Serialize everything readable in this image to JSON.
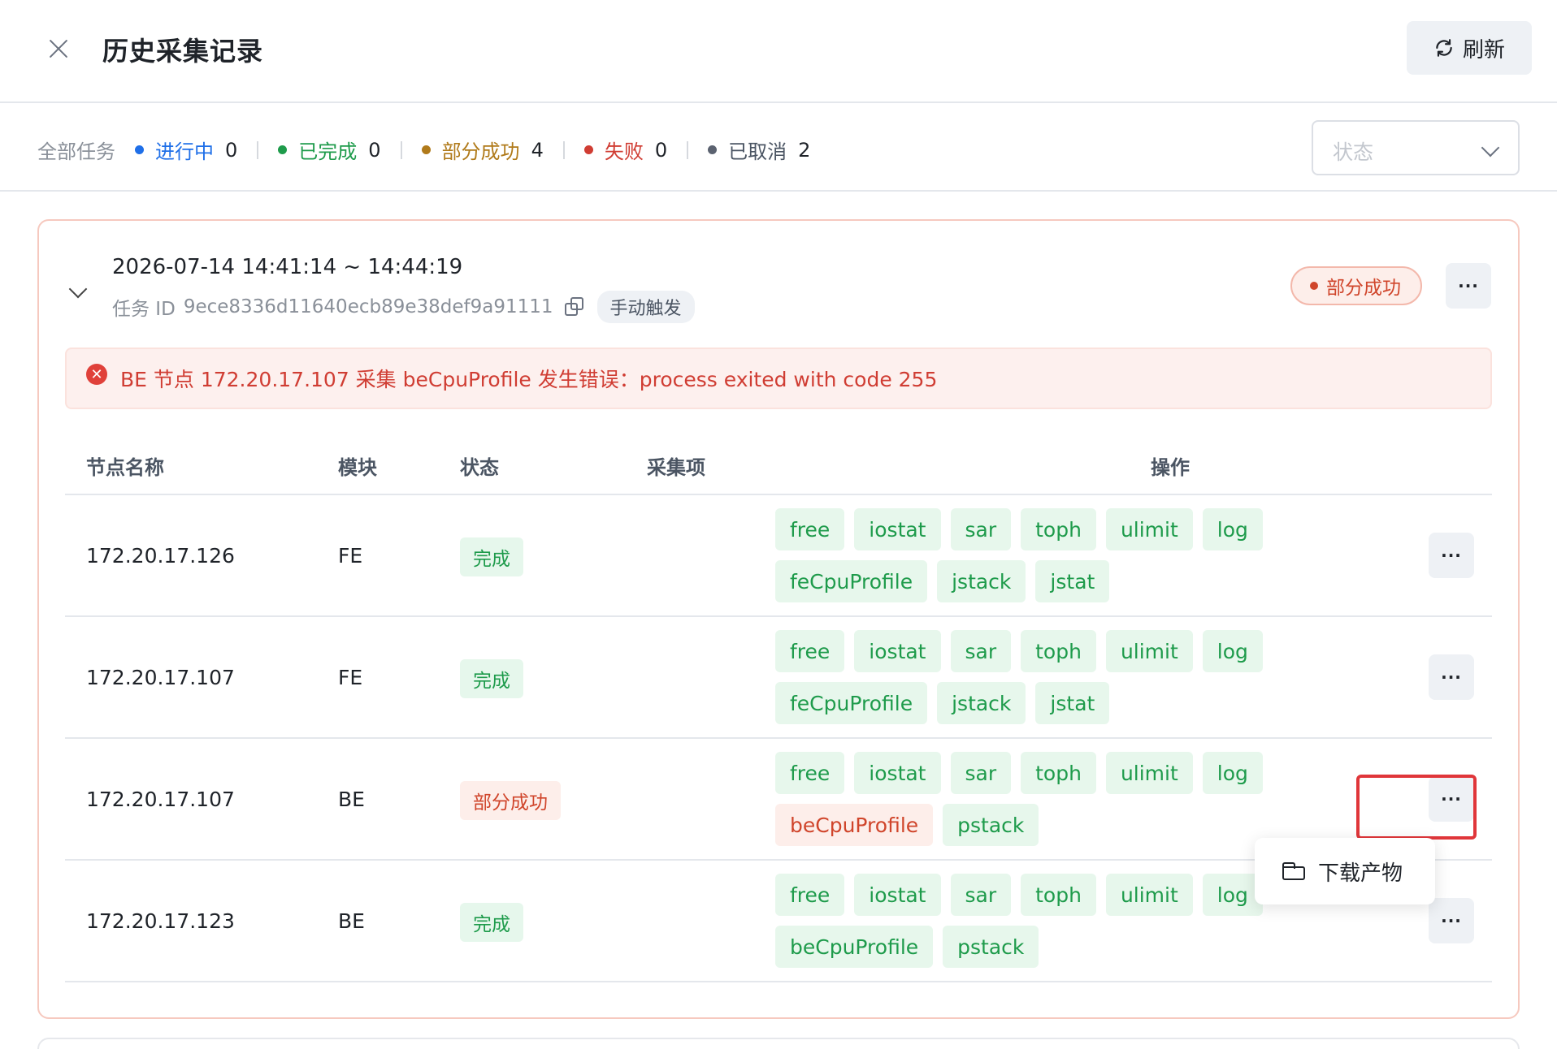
{
  "header": {
    "title": "历史采集记录",
    "refresh_label": "刷新"
  },
  "filters": {
    "all_label": "全部任务",
    "stats": [
      {
        "label": "进行中",
        "count": "0",
        "color": "#1f6fe8"
      },
      {
        "label": "已完成",
        "count": "0",
        "color": "#1e9b4b"
      },
      {
        "label": "部分成功",
        "count": "4",
        "color": "#b07a1a"
      },
      {
        "label": "失败",
        "count": "0",
        "color": "#d03d33"
      },
      {
        "label": "已取消",
        "count": "2",
        "color": "#4b5563"
      }
    ],
    "status_placeholder": "状态"
  },
  "task": {
    "time_range": "2026-07-14 14:41:14 ~ 14:44:19",
    "task_id_label": "任务 ID",
    "task_id": "9ece8336d11640ecb89e38def9a91111",
    "trigger": "手动触发",
    "status": "部分成功",
    "more": "···",
    "error": "BE 节点 172.20.17.107 采集 beCpuProfile 发生错误：process exited with code 255"
  },
  "table": {
    "headers": {
      "node": "节点名称",
      "module": "模块",
      "status": "状态",
      "items": "采集项",
      "actions": "操作"
    },
    "rows": [
      {
        "node": "172.20.17.126",
        "module": "FE",
        "status": "完成",
        "items": [
          "free",
          "iostat",
          "sar",
          "toph",
          "ulimit",
          "log",
          "feCpuProfile",
          "jstack",
          "jstat"
        ],
        "more": "···"
      },
      {
        "node": "172.20.17.107",
        "module": "FE",
        "status": "完成",
        "items": [
          "free",
          "iostat",
          "sar",
          "toph",
          "ulimit",
          "log",
          "feCpuProfile",
          "jstack",
          "jstat"
        ],
        "more": "···"
      },
      {
        "node": "172.20.17.107",
        "module": "BE",
        "status": "部分成功",
        "items": [
          "free",
          "iostat",
          "sar",
          "toph",
          "ulimit",
          "log",
          "beCpuProfile",
          "pstack"
        ],
        "more": "···"
      },
      {
        "node": "172.20.17.123",
        "module": "BE",
        "status": "完成",
        "items": [
          "free",
          "iostat",
          "sar",
          "toph",
          "ulimit",
          "log",
          "beCpuProfile",
          "pstack"
        ],
        "more": "···"
      }
    ]
  },
  "dropdown": {
    "download_label": "下载产物"
  },
  "colors": {
    "success": "#1e9b4b",
    "error": "#d0452b",
    "highlight": "#e0363a"
  }
}
